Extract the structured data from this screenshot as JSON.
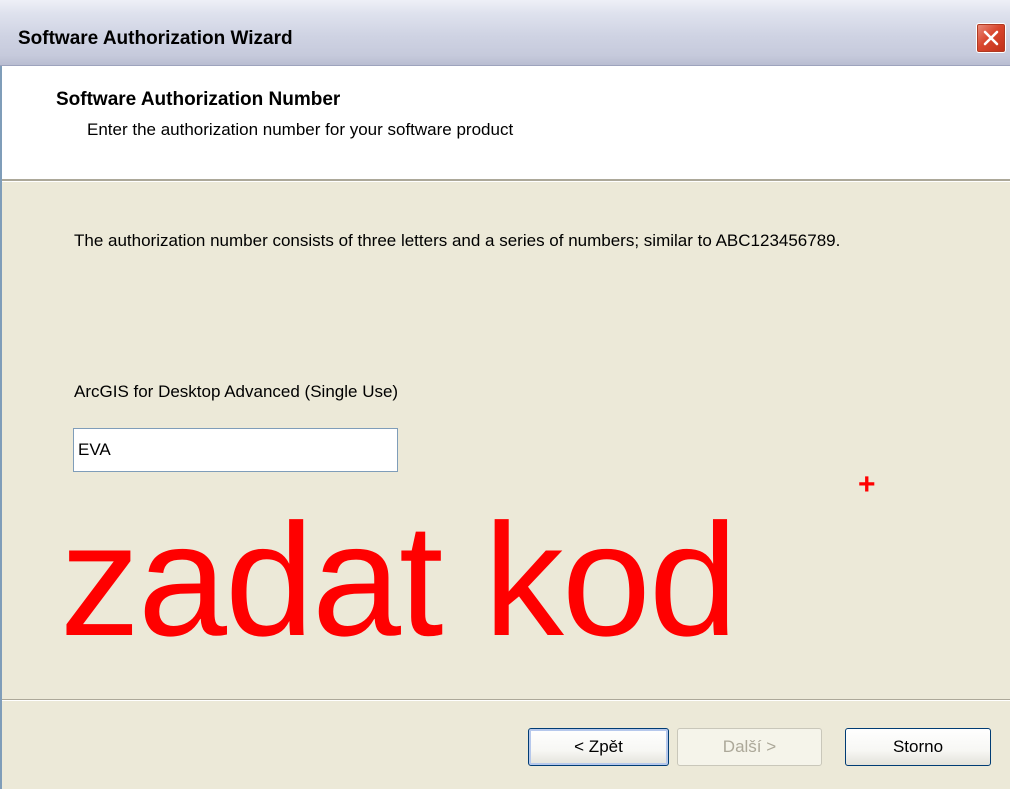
{
  "window": {
    "title": "Software Authorization Wizard",
    "close_glyph": "✕"
  },
  "header": {
    "title": "Software Authorization Number",
    "subtitle": "Enter the authorization number for your software product"
  },
  "body": {
    "description": "The authorization number consists of three letters and a series of numbers; similar to ABC123456789.",
    "product_label": "ArcGIS for Desktop Advanced (Single Use)",
    "auth_input_value": "EVA"
  },
  "annotation": {
    "text": "zadat kod",
    "plus": "+",
    "color": "#ff0000"
  },
  "buttons": {
    "back_label": "< Zpět",
    "next_label": "Další >",
    "cancel_label": "Storno"
  }
}
